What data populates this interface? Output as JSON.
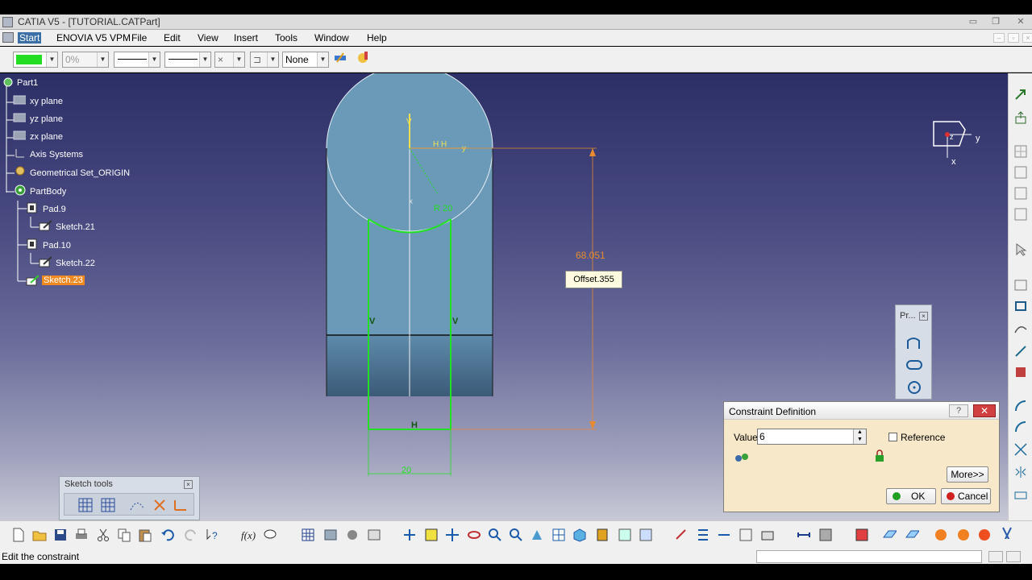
{
  "window": {
    "title": "CATIA V5 - [TUTORIAL.CATPart]",
    "min": "▭",
    "max": "❐",
    "close": "✕"
  },
  "menu": {
    "items": [
      "Start",
      "ENOVIA V5 VPM",
      "File",
      "Edit",
      "View",
      "Insert",
      "Tools",
      "Window",
      "Help"
    ],
    "active": "Start"
  },
  "toolbar": {
    "color_value": "",
    "transparency": "0%",
    "line_thickness": "",
    "line_type": "",
    "point_type": "×",
    "layer": "None"
  },
  "tree": {
    "root": "Part1",
    "items": [
      "xy plane",
      "yz plane",
      "zx plane",
      "Axis Systems",
      "Geometrical Set_ORIGIN",
      "PartBody",
      "Pad.9",
      "Sketch.21",
      "Pad.10",
      "Sketch.22",
      "Sketch.23"
    ],
    "selected": "Sketch.23"
  },
  "sketch": {
    "dim_vertical": "68.051",
    "dim_radius": "R 20",
    "dim_width": "20",
    "offset_label": "Offset.355",
    "axis_h": "H",
    "axis_v": "V",
    "axis_y": "y"
  },
  "compass": {
    "y": "y",
    "x": "x",
    "z": "z"
  },
  "sketch_tools": {
    "title": "Sketch tools"
  },
  "profile_toolbar": {
    "title": "Pr..."
  },
  "constraint_dialog": {
    "title": "Constraint Definition",
    "value_label": "Value",
    "value": "6",
    "reference_label": "Reference",
    "more_label": "More>>",
    "ok_label": "OK",
    "cancel_label": "Cancel",
    "help_icon": "?"
  },
  "status": {
    "text": "Edit the constraint"
  },
  "colors": {
    "sketch_green": "#22e022",
    "dim_orange": "#e88a30",
    "part_blue": "#6a9ab8",
    "selected_orange": "#f08a20"
  }
}
